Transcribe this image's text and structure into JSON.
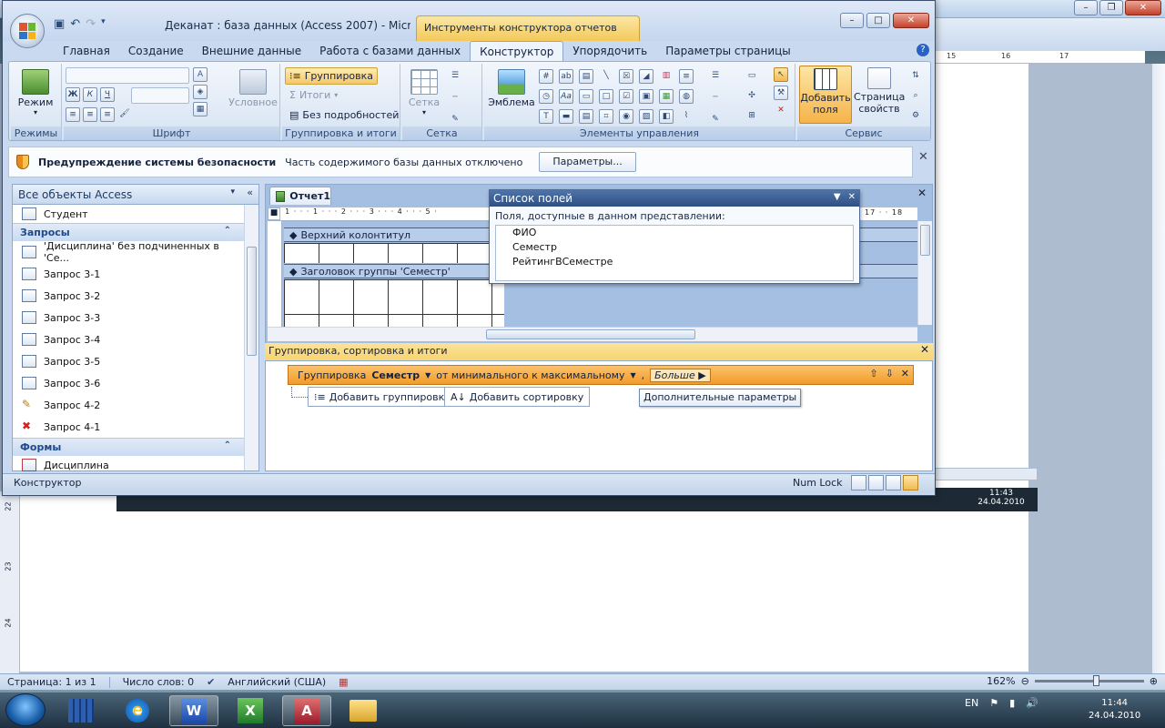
{
  "word": {
    "ruler_numbers": [
      "15",
      "16",
      "17"
    ],
    "vruler_numbers": [
      "22",
      "23",
      "24"
    ],
    "status": {
      "page": "Страница: 1 из 1",
      "words": "Число слов: 0",
      "language": "Английский (США)",
      "zoom": "162%"
    },
    "screenshot_clock": {
      "time": "11:43",
      "date": "24.04.2010"
    }
  },
  "access": {
    "title": "Деканат : база данных (Access 2007) - Microsoft Access",
    "context_tab": "Инструменты конструктора отчетов",
    "tabs": [
      "Главная",
      "Создание",
      "Внешние данные",
      "Работа с базами данных",
      "Конструктор",
      "Упорядочить",
      "Параметры страницы"
    ],
    "active_tab": "Конструктор",
    "ribbon": {
      "groups": {
        "views": "Режимы",
        "font": "Шрифт",
        "grouping": "Группировка и итоги",
        "grid": "Сетка",
        "controls": "Элементы управления",
        "service": "Сервис"
      },
      "view_button": "Режим",
      "conditional": "Условное",
      "grouping_button": "Группировка",
      "totals": "Итоги",
      "hide_details": "Без подробностей",
      "grid_button": "Сетка",
      "logo_button": "Эмблема",
      "add_fields": "Добавить поля",
      "property_sheet": "Страница свойств",
      "font_bold": "Ж",
      "font_italic": "К",
      "font_underline": "Ч"
    },
    "security_bar": {
      "title": "Предупреждение системы безопасности",
      "message": "Часть содержимого базы данных отключено",
      "button": "Параметры..."
    },
    "nav": {
      "header": "Все объекты Access",
      "top_item": "Студент",
      "sections": [
        {
          "name": "Запросы",
          "items": [
            "'Дисциплина' без подчиненных в 'Се...",
            "Запрос 3-1",
            "Запрос 3-2",
            "Запрос 3-3",
            "Запрос 3-4",
            "Запрос 3-5",
            "Запрос 3-6",
            "Запрос 4-2",
            "Запрос 4-1"
          ]
        },
        {
          "name": "Формы",
          "items": [
            "Дисциплина"
          ]
        }
      ]
    },
    "document": {
      "tab": "Отчет1",
      "ruler_text": "· 1 · · · 1 · · · 2 · · · 3 · · · 4 · · · 5 ·",
      "ruler_right": "17 · · 18",
      "header_section": "Верхний колонтитул",
      "group_section": "Заголовок группы 'Семестр'"
    },
    "field_list": {
      "title": "Список полей",
      "subtitle": "Поля, доступные в данном представлении:",
      "fields": [
        "ФИО",
        "Семестр",
        "РейтингВСеместре"
      ]
    },
    "grouping_pane": {
      "title": "Группировка, сортировка и итоги",
      "row": {
        "prefix": "Группировка",
        "field": "Семестр",
        "order": "от минимального к максимальному",
        "more": "Больше"
      },
      "add_group": "Добавить группировку",
      "add_sort": "Добавить сортировку",
      "tooltip": "Дополнительные параметры"
    },
    "status": {
      "mode": "Конструктор",
      "numlock": "Num Lock"
    }
  },
  "taskbar": {
    "lang": "EN",
    "time": "11:44",
    "date": "24.04.2010"
  }
}
